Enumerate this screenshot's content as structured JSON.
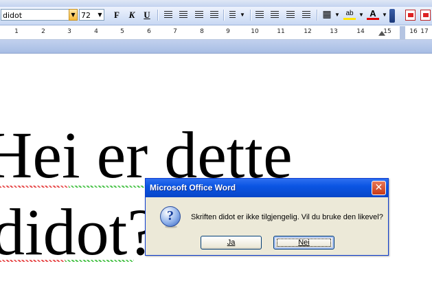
{
  "toolbar": {
    "font_name": "didot",
    "font_size": "72",
    "bold_label": "F",
    "italic_label": "K",
    "underline_label": "U",
    "highlight_label": "ab",
    "font_color_label": "A"
  },
  "ruler": {
    "numbers": [
      "1",
      "2",
      "3",
      "4",
      "5",
      "6",
      "7",
      "8",
      "9",
      "10",
      "11",
      "12",
      "13",
      "14",
      "15",
      "16",
      "17"
    ]
  },
  "document": {
    "line1": "Hei er dette",
    "line2": "didot?"
  },
  "dialog": {
    "title": "Microsoft Office Word",
    "message": "Skriften didot er ikke tilgjengelig. Vil du bruke den likevel?",
    "yes_label": "Ja",
    "no_label": "Nei",
    "close_glyph": "✕",
    "icon": "question-icon"
  },
  "colors": {
    "titlebar": "#0b55e3",
    "close_button": "#c73a18",
    "dialog_bg": "#ece9d8",
    "toolbar": "#c8d8f3"
  }
}
